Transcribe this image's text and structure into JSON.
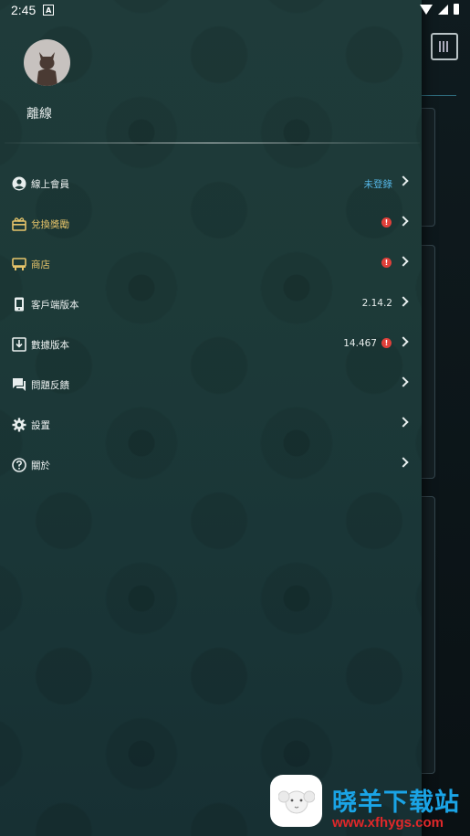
{
  "status_bar": {
    "time": "2:45",
    "notification_letter": "A"
  },
  "profile": {
    "username": "離線"
  },
  "menu": [
    {
      "label": "線上會員",
      "value": "未登錄",
      "badge": "",
      "icon": "account-circle-icon"
    },
    {
      "label": "兌換獎勵",
      "value": "",
      "badge": "!",
      "icon": "gift-icon"
    },
    {
      "label": "商店",
      "value": "",
      "badge": "!",
      "icon": "store-icon"
    },
    {
      "label": "客戶端版本",
      "value": "2.14.2",
      "badge": "",
      "icon": "phone-icon"
    },
    {
      "label": "數據版本",
      "value": "14.467",
      "badge": "!",
      "icon": "download-icon"
    },
    {
      "label": "問題反饋",
      "value": "",
      "badge": "",
      "icon": "feedback-icon"
    },
    {
      "label": "設置",
      "value": "",
      "badge": "",
      "icon": "gear-icon"
    },
    {
      "label": "關於",
      "value": "",
      "badge": "",
      "icon": "help-icon"
    }
  ],
  "watermark": {
    "brand": "晓羊下载站",
    "url": "www.xfhygs.com"
  },
  "colors": {
    "drawer_bg": "#1d3a38",
    "accent_gold": "#e6c46a",
    "accent_blue": "#55b6e6",
    "badge_red": "#e0403a",
    "watermark_blue": "#1aa4e6",
    "watermark_red": "#e0282a"
  }
}
